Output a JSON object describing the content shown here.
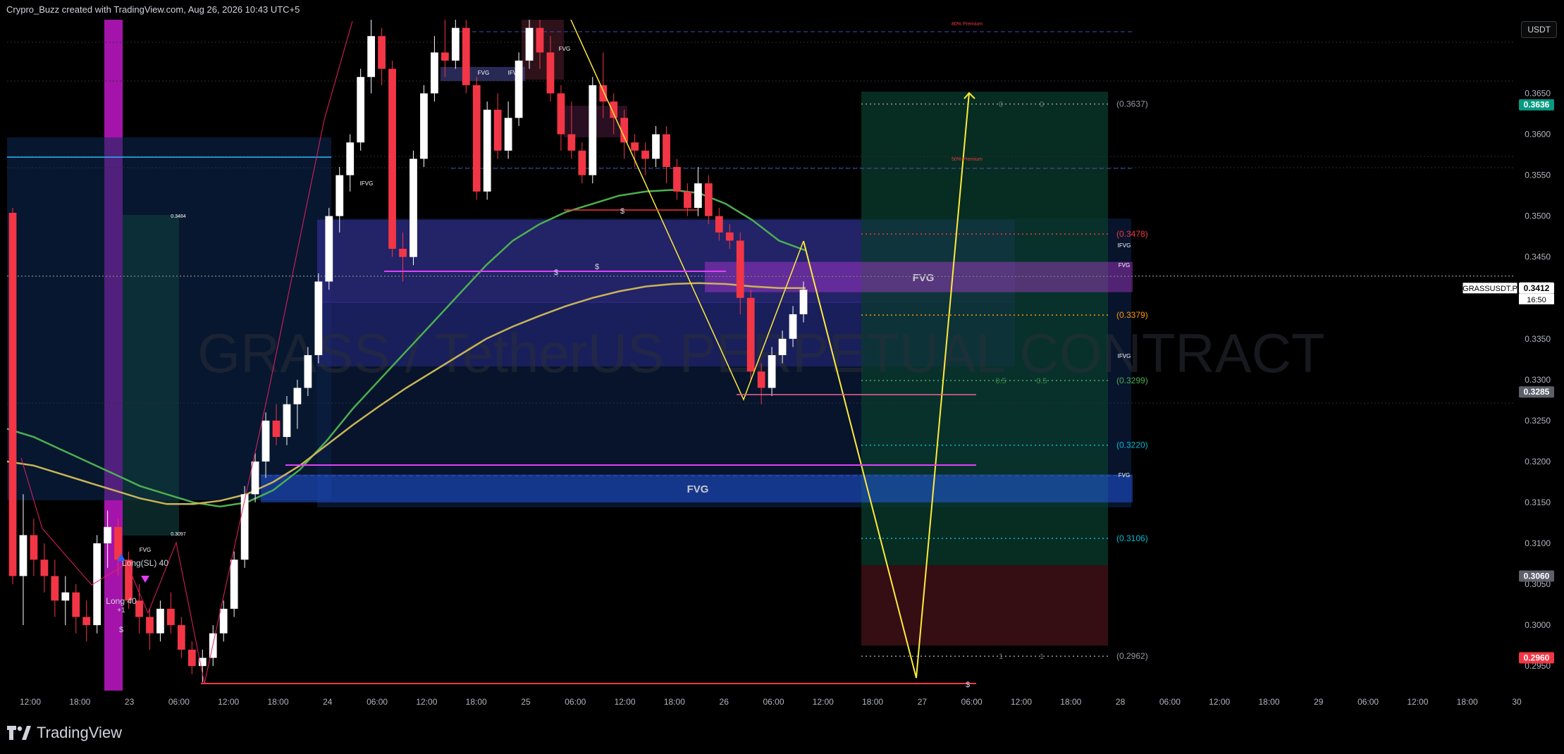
{
  "header": {
    "attribution": "Crypro_Buzz created with TradingView.com, Aug 26, 2026 10:43 UTC+5"
  },
  "footer": {
    "brand": "TradingView",
    "logo_icon": "tradingview-logo-icon"
  },
  "currency_button": "USDT",
  "watermark": "GRASS / TetherUS PERPETUAL CONTRACT",
  "colors": {
    "bull": "#ffffff",
    "bear": "#f23645",
    "accent_green": "#089981",
    "fvg_blue": "#2962ff",
    "yellow": "#ffeb3b",
    "purple": "#e040fb"
  },
  "chart_data": {
    "type": "candlestick",
    "symbol": "GRASSUSDT.P",
    "ylim": [
      0.292,
      0.374
    ],
    "x_ticks": [
      "12:00",
      "18:00",
      "23",
      "06:00",
      "12:00",
      "18:00",
      "24",
      "06:00",
      "12:00",
      "18:00",
      "25",
      "06:00",
      "12:00",
      "18:00",
      "26",
      "06:00",
      "12:00",
      "18:00",
      "27",
      "06:00",
      "12:00",
      "18:00",
      "28",
      "06:00",
      "12:00",
      "18:00",
      "29",
      "06:00",
      "12:00",
      "18:00",
      "30"
    ],
    "y_ticks": [
      "0.3650",
      "0.3600",
      "0.3550",
      "0.3500",
      "0.3450",
      "0.3350",
      "0.3300",
      "0.3250",
      "0.3200",
      "0.3150",
      "0.3100",
      "0.3050",
      "0.3000",
      "0.2950"
    ],
    "price_badges": [
      {
        "label": "0.3636",
        "value": 0.3636,
        "color": "#089981"
      },
      {
        "label": "0.3412",
        "value": 0.3412,
        "color": "#ffffff",
        "symbol": "GRASSUSDT.P",
        "countdown": "16:50"
      },
      {
        "label": "0.3285",
        "value": 0.3285,
        "color": "#5d606b"
      },
      {
        "label": "0.3060",
        "value": 0.306,
        "color": "#5d606b"
      },
      {
        "label": "0.2960",
        "value": 0.296,
        "color": "#f23645"
      }
    ],
    "fib_levels": [
      {
        "label": "(0.3637)",
        "value": 0.3637,
        "color": "#9598a1",
        "left_text": "0",
        "right_text": "0"
      },
      {
        "label": "(0.3478)",
        "value": 0.3478,
        "color": "#f23645"
      },
      {
        "label": "(0.3379)",
        "value": 0.3379,
        "color": "#ff9800"
      },
      {
        "label": "(0.3299)",
        "value": 0.3299,
        "color": "#4caf50",
        "left_text": "0.5",
        "right_text": "0.5"
      },
      {
        "label": "(0.3220)",
        "value": 0.322,
        "color": "#00bcd4"
      },
      {
        "label": "(0.3106)",
        "value": 0.3106,
        "color": "#00bcd4"
      },
      {
        "label": "(0.2962)",
        "value": 0.2962,
        "color": "#9598a1",
        "left_text": "1",
        "right_text": "1"
      }
    ],
    "zones": [
      {
        "label": "FVG",
        "top": 0.3444,
        "bottom": 0.3407,
        "color": "#e040fb"
      },
      {
        "label": "FVG",
        "top": 0.3184,
        "bottom": 0.315,
        "color": "#2962ff"
      }
    ],
    "annotations": [
      "Long(SL) 40",
      "Long 40",
      "+1",
      "$",
      "IFVG",
      "FVG",
      "0.3484",
      "0.3097",
      "80% Premium",
      "50% Premium"
    ],
    "candles": [
      [
        0.3504,
        0.351,
        0.305,
        0.306
      ],
      [
        0.306,
        0.316,
        0.3,
        0.311
      ],
      [
        0.311,
        0.313,
        0.306,
        0.308
      ],
      [
        0.308,
        0.31,
        0.304,
        0.306
      ],
      [
        0.306,
        0.308,
        0.301,
        0.303
      ],
      [
        0.303,
        0.306,
        0.3,
        0.304
      ],
      [
        0.304,
        0.305,
        0.299,
        0.301
      ],
      [
        0.301,
        0.303,
        0.298,
        0.3
      ],
      [
        0.3,
        0.311,
        0.299,
        0.31
      ],
      [
        0.31,
        0.314,
        0.307,
        0.312
      ],
      [
        0.312,
        0.313,
        0.306,
        0.308
      ],
      [
        0.308,
        0.309,
        0.302,
        0.303
      ],
      [
        0.303,
        0.305,
        0.299,
        0.301
      ],
      [
        0.301,
        0.302,
        0.297,
        0.299
      ],
      [
        0.299,
        0.303,
        0.298,
        0.302
      ],
      [
        0.302,
        0.304,
        0.299,
        0.3
      ],
      [
        0.3,
        0.301,
        0.296,
        0.297
      ],
      [
        0.297,
        0.298,
        0.294,
        0.295
      ],
      [
        0.295,
        0.297,
        0.293,
        0.296
      ],
      [
        0.296,
        0.3,
        0.295,
        0.299
      ],
      [
        0.299,
        0.303,
        0.298,
        0.302
      ],
      [
        0.302,
        0.309,
        0.301,
        0.308
      ],
      [
        0.308,
        0.317,
        0.307,
        0.316
      ],
      [
        0.316,
        0.321,
        0.315,
        0.32
      ],
      [
        0.32,
        0.326,
        0.318,
        0.325
      ],
      [
        0.325,
        0.327,
        0.322,
        0.323
      ],
      [
        0.323,
        0.328,
        0.322,
        0.327
      ],
      [
        0.327,
        0.33,
        0.324,
        0.329
      ],
      [
        0.329,
        0.334,
        0.328,
        0.333
      ],
      [
        0.333,
        0.343,
        0.332,
        0.342
      ],
      [
        0.342,
        0.351,
        0.341,
        0.35
      ],
      [
        0.35,
        0.356,
        0.348,
        0.355
      ],
      [
        0.355,
        0.36,
        0.353,
        0.359
      ],
      [
        0.359,
        0.368,
        0.358,
        0.367
      ],
      [
        0.367,
        0.374,
        0.365,
        0.372
      ],
      [
        0.372,
        0.373,
        0.366,
        0.368
      ],
      [
        0.368,
        0.369,
        0.345,
        0.346
      ],
      [
        0.346,
        0.348,
        0.342,
        0.345
      ],
      [
        0.345,
        0.358,
        0.344,
        0.357
      ],
      [
        0.357,
        0.366,
        0.356,
        0.365
      ],
      [
        0.365,
        0.372,
        0.364,
        0.37
      ],
      [
        0.37,
        0.374,
        0.367,
        0.369
      ],
      [
        0.369,
        0.374,
        0.368,
        0.373
      ],
      [
        0.373,
        0.374,
        0.365,
        0.366
      ],
      [
        0.366,
        0.367,
        0.352,
        0.353
      ],
      [
        0.353,
        0.364,
        0.352,
        0.363
      ],
      [
        0.363,
        0.365,
        0.357,
        0.358
      ],
      [
        0.358,
        0.364,
        0.357,
        0.362
      ],
      [
        0.362,
        0.37,
        0.361,
        0.369
      ],
      [
        0.369,
        0.374,
        0.368,
        0.373
      ],
      [
        0.373,
        0.374,
        0.368,
        0.37
      ],
      [
        0.37,
        0.372,
        0.364,
        0.365
      ],
      [
        0.365,
        0.366,
        0.358,
        0.36
      ],
      [
        0.36,
        0.364,
        0.357,
        0.358
      ],
      [
        0.358,
        0.359,
        0.354,
        0.355
      ],
      [
        0.355,
        0.367,
        0.354,
        0.366
      ],
      [
        0.366,
        0.37,
        0.362,
        0.364
      ],
      [
        0.364,
        0.365,
        0.36,
        0.362
      ],
      [
        0.362,
        0.363,
        0.357,
        0.359
      ],
      [
        0.359,
        0.36,
        0.356,
        0.358
      ],
      [
        0.358,
        0.359,
        0.355,
        0.357
      ],
      [
        0.357,
        0.361,
        0.356,
        0.36
      ],
      [
        0.36,
        0.361,
        0.354,
        0.356
      ],
      [
        0.356,
        0.357,
        0.352,
        0.353
      ],
      [
        0.353,
        0.354,
        0.35,
        0.351
      ],
      [
        0.351,
        0.356,
        0.35,
        0.354
      ],
      [
        0.354,
        0.355,
        0.349,
        0.35
      ],
      [
        0.35,
        0.351,
        0.347,
        0.348
      ],
      [
        0.348,
        0.349,
        0.346,
        0.347
      ],
      [
        0.347,
        0.348,
        0.338,
        0.34
      ],
      [
        0.34,
        0.341,
        0.33,
        0.331
      ],
      [
        0.331,
        0.332,
        0.327,
        0.329
      ],
      [
        0.329,
        0.334,
        0.328,
        0.333
      ],
      [
        0.333,
        0.336,
        0.332,
        0.335
      ],
      [
        0.335,
        0.339,
        0.334,
        0.338
      ],
      [
        0.338,
        0.342,
        0.337,
        0.341
      ]
    ],
    "ema_fast": [
      0.324,
      0.323,
      0.3215,
      0.32,
      0.3185,
      0.317,
      0.316,
      0.315,
      0.3145,
      0.315,
      0.3165,
      0.319,
      0.3225,
      0.3265,
      0.33,
      0.3335,
      0.337,
      0.3405,
      0.344,
      0.347,
      0.349,
      0.3505,
      0.3515,
      0.3525,
      0.353,
      0.3532,
      0.3528,
      0.3515,
      0.3495,
      0.347,
      0.3458
    ],
    "ema_slow": [
      0.32,
      0.3195,
      0.3185,
      0.3175,
      0.3165,
      0.3155,
      0.3148,
      0.3148,
      0.3152,
      0.316,
      0.3175,
      0.3195,
      0.322,
      0.3245,
      0.3268,
      0.329,
      0.331,
      0.333,
      0.335,
      0.3365,
      0.3378,
      0.339,
      0.34,
      0.3408,
      0.3414,
      0.3417,
      0.3418,
      0.3417,
      0.3414,
      0.3412,
      0.3412
    ]
  }
}
